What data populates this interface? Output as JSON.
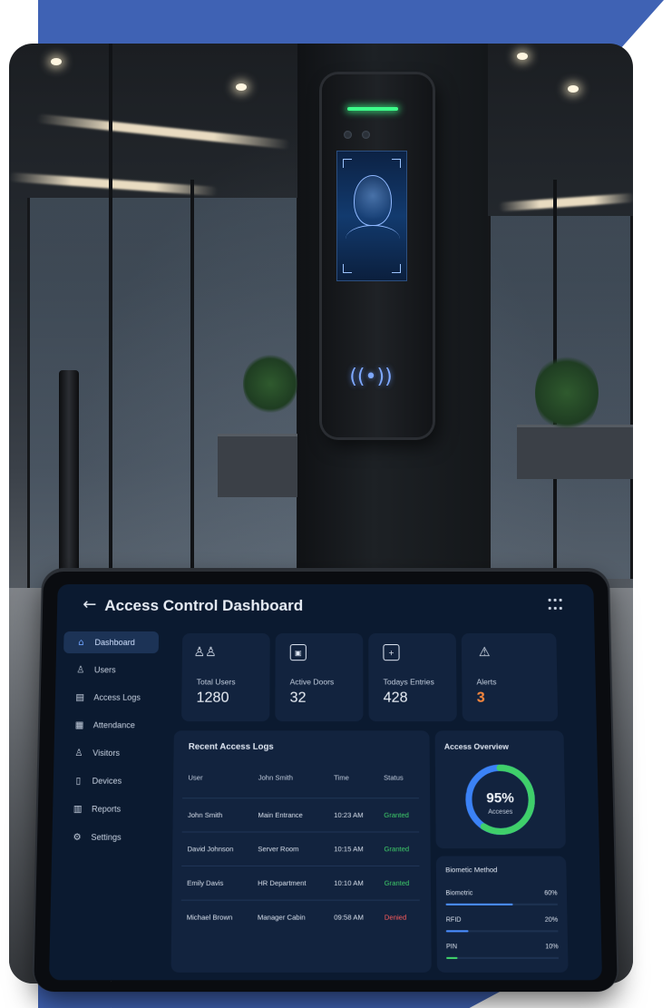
{
  "app": {
    "title": "Access Control Dashboard"
  },
  "icons": {
    "back": "arrow-left-icon",
    "menu": "grid-menu-icon",
    "nfc": "nfc-icon"
  },
  "sidebar": {
    "items": [
      {
        "label": "Dashboard",
        "icon": "home-icon",
        "glyph": "⌂",
        "active": true
      },
      {
        "label": "Users",
        "icon": "user-icon",
        "glyph": "♙",
        "active": false
      },
      {
        "label": "Access Logs",
        "icon": "log-icon",
        "glyph": "▤",
        "active": false
      },
      {
        "label": "Attendance",
        "icon": "calendar-icon",
        "glyph": "▦",
        "active": false
      },
      {
        "label": "Visitors",
        "icon": "visitors-icon",
        "glyph": "♙",
        "active": false
      },
      {
        "label": "Devices",
        "icon": "device-icon",
        "glyph": "▯",
        "active": false
      },
      {
        "label": "Reports",
        "icon": "report-icon",
        "glyph": "▥",
        "active": false
      },
      {
        "label": "Settings",
        "icon": "gear-icon",
        "glyph": "⚙",
        "active": false
      }
    ]
  },
  "stats": [
    {
      "label": "Total Users",
      "value": "1280",
      "icon": "users-icon",
      "glyph": "♙♙"
    },
    {
      "label": "Active Doors",
      "value": "32",
      "icon": "door-icon",
      "glyph": "▣"
    },
    {
      "label": "Todays Entries",
      "value": "428",
      "icon": "entry-icon",
      "glyph": "+"
    },
    {
      "label": "Alerts",
      "value": "3",
      "icon": "warning-icon",
      "glyph": "⚠"
    }
  ],
  "logs": {
    "title": "Recent Access Logs",
    "headers": {
      "user": "User",
      "location": "John Smith",
      "time": "Time",
      "status": "Status"
    },
    "rows": [
      {
        "user": "John Smith",
        "location": "Main Entrance",
        "time": "10:23 AM",
        "status": "Granted"
      },
      {
        "user": "David Johnson",
        "location": "Server Room",
        "time": "10:15 AM",
        "status": "Granted"
      },
      {
        "user": "Emily Davis",
        "location": "HR Department",
        "time": "10:10 AM",
        "status": "Granted"
      },
      {
        "user": "Michael Brown",
        "location": "Manager Cabin",
        "time": "09:58 AM",
        "status": "Denied"
      }
    ]
  },
  "overview": {
    "title": "Access Overview",
    "percent": 95,
    "percent_text": "95%",
    "label": "Acceses"
  },
  "biometric": {
    "title": "Biometic Method",
    "methods": [
      {
        "name": "Biometric",
        "percent_text": "60%",
        "fraction": 0.6,
        "color": "#4a8dff"
      },
      {
        "name": "RFID",
        "percent_text": "20%",
        "fraction": 0.2,
        "color": "#4a8dff"
      },
      {
        "name": "PIN",
        "percent_text": "10%",
        "fraction": 0.1,
        "color": "#3fcf6a"
      }
    ]
  },
  "colors": {
    "brand_band": "#3f62b4",
    "screen_bg": "#0b1a30",
    "card_bg": "#12233e",
    "granted": "#3fcf6a",
    "denied": "#ff5c5c",
    "alert": "#ff8a3d",
    "donut_blue": "#3b82f6",
    "donut_green": "#3fcf6a"
  }
}
